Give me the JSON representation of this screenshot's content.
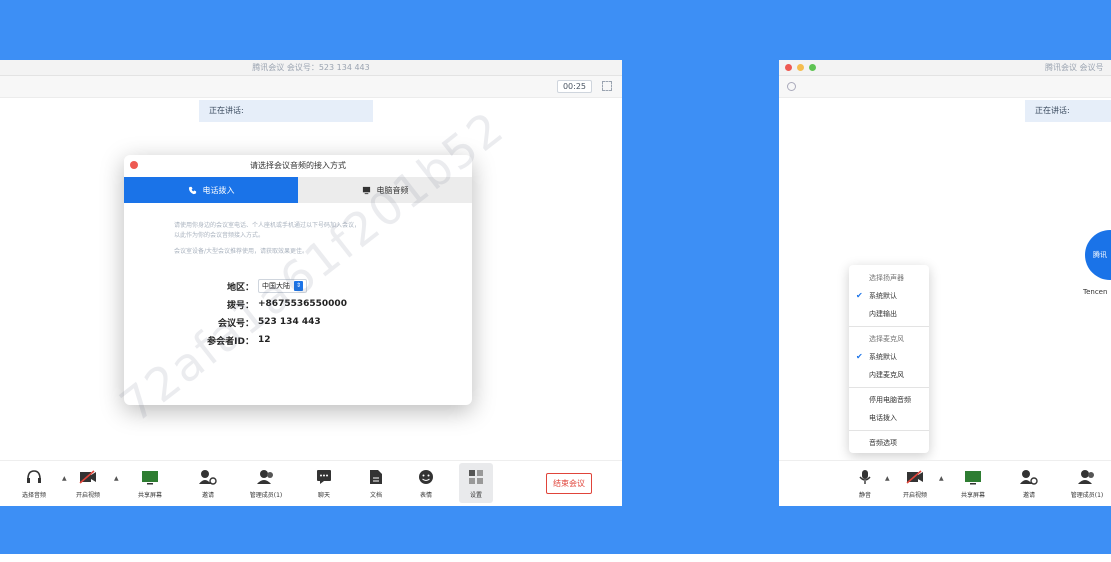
{
  "left_window": {
    "title": "腾讯会议 会议号：523 134 443",
    "timer": "00:25",
    "speaking": "正在讲话:",
    "dialog": {
      "title": "请选择会议音频的接入方式",
      "tab_phone": "电话拨入",
      "tab_computer": "电脑音频",
      "desc1": "请使用你身边的会议室电话、个人座机或手机通过以下号码加入会议，",
      "desc2": "以此作为你的会议音频接入方式。",
      "desc3": "会议室设备/大型会议推荐使用，请获取效果更佳。",
      "region_label": "地区：",
      "region_value": "中国大陆",
      "dial_label": "拨号：",
      "dial_value": "+8675536550000",
      "meeting_label": "会议号：",
      "meeting_value": "523 134 443",
      "participant_label": "参会者ID：",
      "participant_value": "12"
    },
    "toolbar": {
      "audio": "选择音频",
      "video": "开启视频",
      "share": "共享屏幕",
      "invite": "邀请",
      "manage": "管理成员(1)",
      "chat": "聊天",
      "docs": "文档",
      "emoji": "表情",
      "settings": "设置",
      "end": "结束会议"
    }
  },
  "right_window": {
    "title": "腾讯会议 会议号",
    "speaking": "正在讲话:",
    "avatar_text": "腾讯",
    "avatar_name": "Tencen",
    "menu": {
      "speaker_header": "选择扬声器",
      "speaker_default": "系统默认",
      "speaker_builtin": "内建输出",
      "mic_header": "选择麦克风",
      "mic_default": "系统默认",
      "mic_builtin": "内建麦克风",
      "disable_audio": "停用电脑音频",
      "phone_dial": "电话拨入",
      "audio_options": "音频选项"
    },
    "toolbar": {
      "mute": "静音",
      "video": "开启视频",
      "share": "共享屏幕",
      "invite": "邀请",
      "manage": "管理成员(1)"
    }
  },
  "watermark": "72afa1a61f201b52",
  "colors": {
    "background_blue": "#3d8ff5",
    "accent_blue": "#1a73e8",
    "end_red": "#e0443a"
  }
}
